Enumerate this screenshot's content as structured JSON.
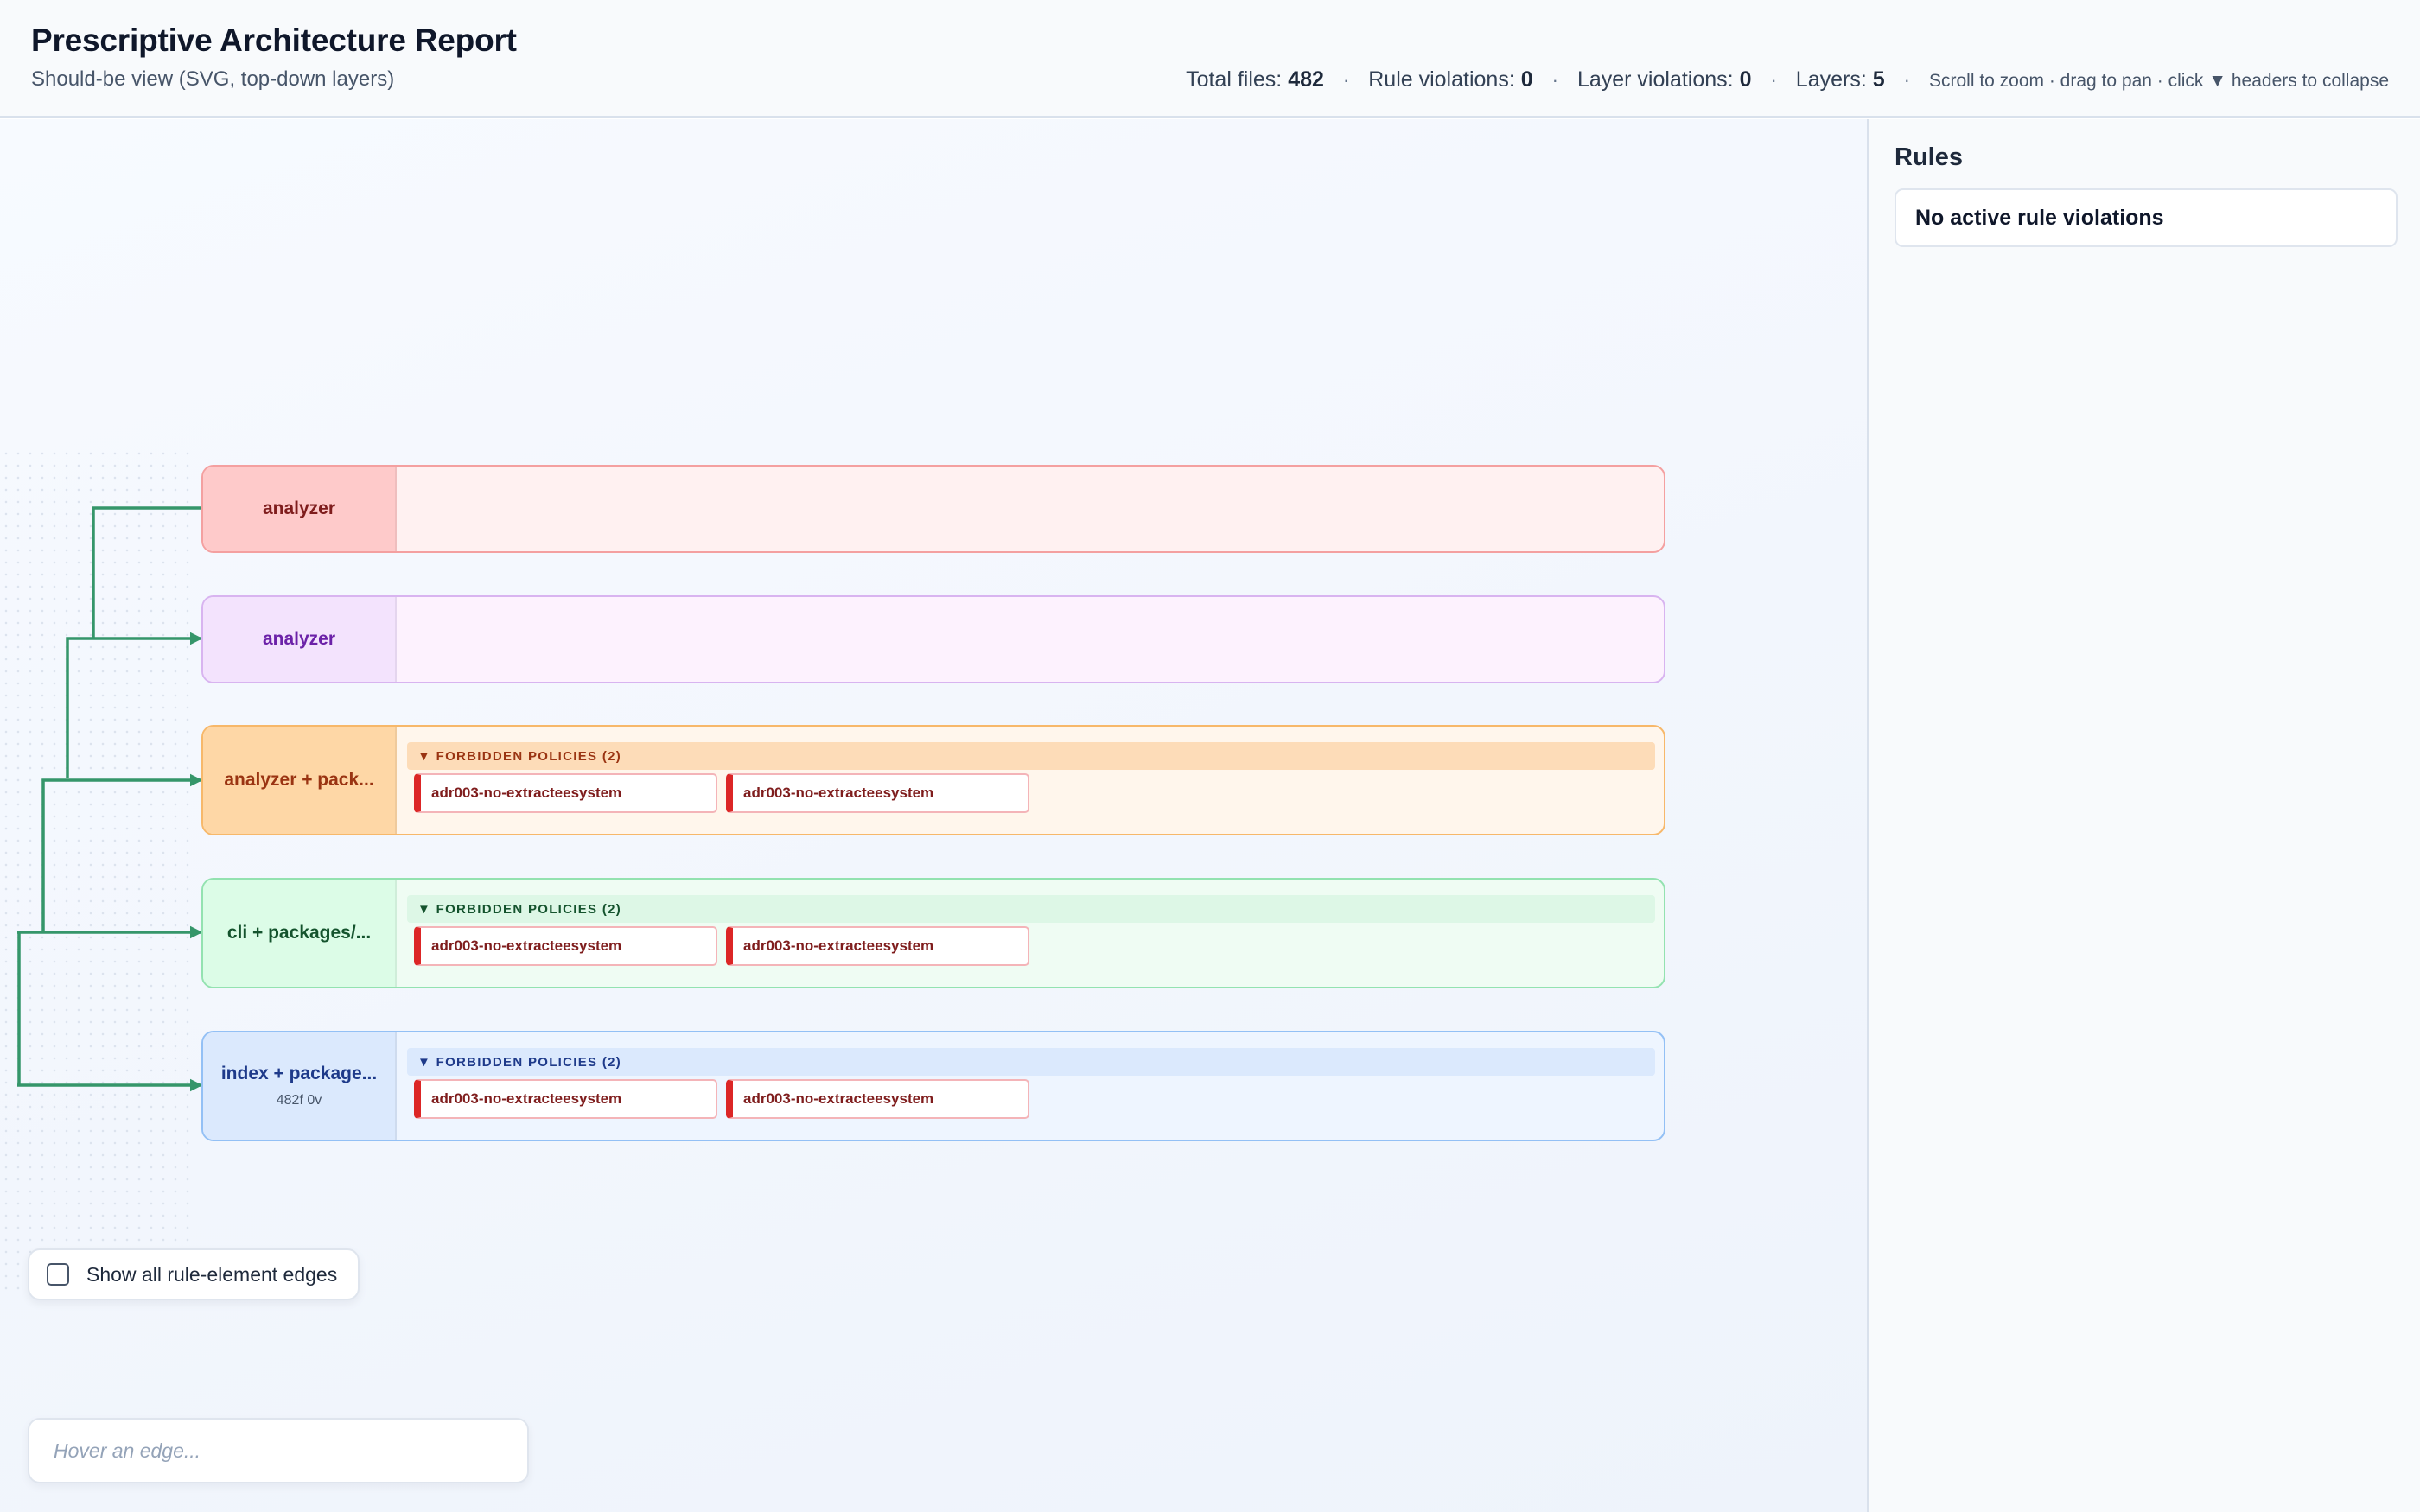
{
  "header": {
    "title": "Prescriptive Architecture Report",
    "subtitle": "Should-be view (SVG, top-down layers)",
    "stats": {
      "total_files_label": "Total files:",
      "total_files": "482",
      "rule_violations_label": "Rule violations:",
      "rule_violations": "0",
      "layer_violations_label": "Layer violations:",
      "layer_violations": "0",
      "layers_label": "Layers:",
      "layers": "5",
      "separator": "·",
      "hint": "Scroll to zoom · drag to pan · click ▼ headers to collapse"
    }
  },
  "layers": [
    {
      "name": "analyzer",
      "colors": {
        "bg": "#fff1f1",
        "border": "#f4a0a0",
        "head_bg": "#fecaca",
        "text": "#7f1d1d"
      }
    },
    {
      "name": "analyzer",
      "colors": {
        "bg": "#fdf2fe",
        "border": "#d8b4f0",
        "head_bg": "#f3e3fd",
        "text": "#6b21a8"
      }
    },
    {
      "name": "analyzer + pack...",
      "colors": {
        "bg": "#fff6ec",
        "border": "#f7b86a",
        "head_bg": "#fed7a6",
        "text": "#9a3412",
        "bar_bg": "#fddcb8"
      },
      "group": {
        "title": "▼ FORBIDDEN POLICIES (2)",
        "items": [
          "adr003-no-extracteesystem",
          "adr003-no-extracteesystem"
        ]
      }
    },
    {
      "name": "cli + packages/...",
      "colors": {
        "bg": "#effcf3",
        "border": "#93e2b0",
        "head_bg": "#dcfce7",
        "text": "#14532d",
        "bar_bg": "#ddf7e6"
      },
      "group": {
        "title": "▼ FORBIDDEN POLICIES (2)",
        "items": [
          "adr003-no-extracteesystem",
          "adr003-no-extracteesystem"
        ]
      }
    },
    {
      "name": "index + package...",
      "meta": "482f 0v",
      "colors": {
        "bg": "#eef5ff",
        "border": "#93c0f5",
        "head_bg": "#dbe9fd",
        "text": "#1e3a8a",
        "bar_bg": "#dbe9fd"
      },
      "group": {
        "title": "▼ FORBIDDEN POLICIES (2)",
        "items": [
          "adr003-no-extracteesystem",
          "adr003-no-extracteesystem"
        ]
      }
    }
  ],
  "edge_color": "#35966a",
  "toggle": {
    "label": "Show all rule-element edges",
    "checked": false
  },
  "hover_box": {
    "placeholder": "Hover an edge..."
  },
  "sidebar": {
    "title": "Rules",
    "empty_message": "No active rule violations"
  }
}
